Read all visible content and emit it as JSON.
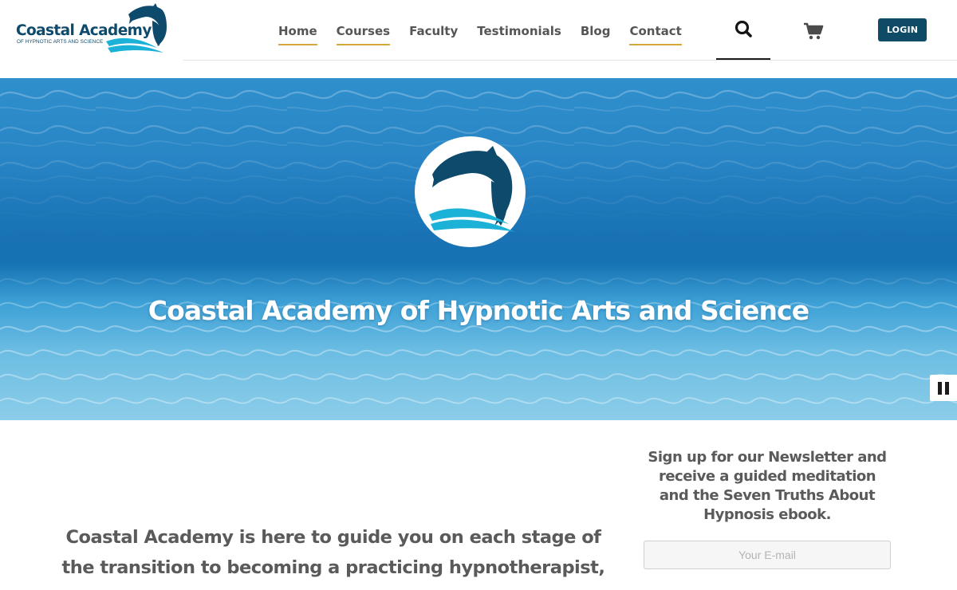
{
  "brand": {
    "name": "Coastal Academy",
    "tagline": "OF HYPNOTIC ARTS AND SCIENCE"
  },
  "nav": [
    {
      "label": "Home",
      "underlined": true
    },
    {
      "label": "Courses",
      "underlined": true
    },
    {
      "label": "Faculty",
      "underlined": false
    },
    {
      "label": "Testimonials",
      "underlined": false
    },
    {
      "label": "Blog",
      "underlined": false
    },
    {
      "label": "Contact",
      "underlined": true
    }
  ],
  "header": {
    "search_icon": "search-icon",
    "cart_icon": "cart-icon",
    "login_label": "LOGIN"
  },
  "hero": {
    "title": "Coastal Academy of Hypnotic Arts and Science",
    "badge_icon": "dolphin-logo",
    "pause_icon": "pause-icon"
  },
  "intro": {
    "text": "Coastal Academy is here to guide you on each stage of the transition to becoming a practicing hypnotherapist, and the"
  },
  "newsletter": {
    "heading": "Sign up for our Newsletter and receive a guided meditation and the Seven Truths About Hypnosis ebook.",
    "email_placeholder": "Your E-mail"
  },
  "colors": {
    "brand_navy": "#0f4a66",
    "nav_accent": "#d6a73a",
    "wave_cyan": "#1cb2d8"
  }
}
